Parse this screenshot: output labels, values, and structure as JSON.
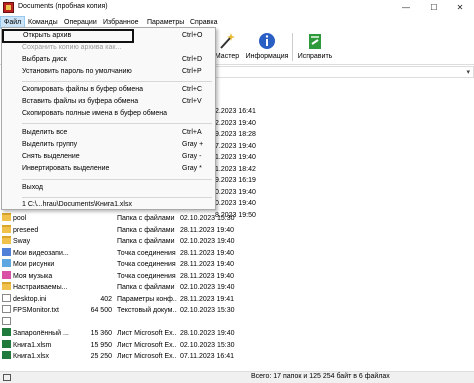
{
  "window": {
    "title": "Documents (пробная копия)"
  },
  "menubar": [
    "Файл",
    "Команды",
    "Операции",
    "Избранное",
    "Параметры",
    "Справка"
  ],
  "toolbar": [
    {
      "label": "Мастер",
      "icon": "wizard-icon"
    },
    {
      "label": "Информация",
      "icon": "info-icon"
    },
    {
      "label": "Исправить",
      "icon": "repair-icon"
    }
  ],
  "file_menu": {
    "items": [
      {
        "label": "Открыть архив",
        "shortcut": "Ctrl+O",
        "enabled": true,
        "highlight": true
      },
      {
        "label": "Сохранить копию архива как...",
        "shortcut": "",
        "enabled": false
      },
      {
        "label": "Выбрать диск",
        "shortcut": "Ctrl+D",
        "enabled": true
      },
      {
        "label": "Установить пароль по умолчанию",
        "shortcut": "Ctrl+P",
        "enabled": true
      },
      {
        "label": "Скопировать файлы в буфер обмена",
        "shortcut": "Ctrl+C",
        "enabled": true
      },
      {
        "label": "Вставить файлы из буфера обмена",
        "shortcut": "Ctrl+V",
        "enabled": true
      },
      {
        "label": "Скопировать полные имена в буфер обмена",
        "shortcut": "",
        "enabled": true
      },
      {
        "label": "Выделить все",
        "shortcut": "Ctrl+A",
        "enabled": true
      },
      {
        "label": "Выделить группу",
        "shortcut": "Gray +",
        "enabled": true
      },
      {
        "label": "Снять выделение",
        "shortcut": "Gray -",
        "enabled": true
      },
      {
        "label": "Инвертировать выделение",
        "shortcut": "Gray *",
        "enabled": true
      },
      {
        "label": "Выход",
        "shortcut": "",
        "enabled": true
      },
      {
        "label": "1  C:\\...hrau\\Documents\\Книга1.xlsx",
        "shortcut": "",
        "enabled": true
      }
    ]
  },
  "file_list": {
    "partial_dates": [
      "2.2023 16:41",
      "2.2023 19:40",
      "9.2023 18:28",
      "7.2023 19:40",
      "1.2023 19:40",
      "1.2023 18:42",
      "9.2023 16:19",
      "0.2023 19:40",
      "0.2023 19:40",
      "8.2023 19:50",
      "9.2023 19:40",
      "2.2023 19:40",
      "2.2023 16:41"
    ],
    "rows": [
      {
        "name": "pool",
        "size": "",
        "type": "Папка с файлами",
        "modified": "02.10.2023 15:30",
        "icon": "folder"
      },
      {
        "name": "preseed",
        "size": "",
        "type": "Папка с файлами",
        "modified": "28.11.2023 19:40",
        "icon": "folder"
      },
      {
        "name": "Sway",
        "size": "",
        "type": "Папка с файлами",
        "modified": "02.10.2023 19:40",
        "icon": "folder"
      },
      {
        "name": "Мои видеозапи...",
        "size": "",
        "type": "Точка соединения",
        "modified": "28.11.2023 19:40",
        "icon": "folder-blue"
      },
      {
        "name": "Мои рисунки",
        "size": "",
        "type": "Точка соединения",
        "modified": "28.11.2023 19:40",
        "icon": "folder-img"
      },
      {
        "name": "Моя музыка",
        "size": "",
        "type": "Точка соединения",
        "modified": "28.11.2023 19:40",
        "icon": "folder-pink"
      },
      {
        "name": "Настраиваемы...",
        "size": "",
        "type": "Папка с файлами",
        "modified": "02.10.2023 19:40",
        "icon": "folder"
      },
      {
        "name": "desktop.ini",
        "size": "402",
        "type": "Параметры конф...",
        "modified": "28.11.2023 19:41",
        "icon": "file"
      },
      {
        "name": "FPSMonitor.txt",
        "size": "64 500",
        "type": "Текстовый докум...",
        "modified": "02.10.2023 15:30",
        "icon": "file"
      },
      {
        "name": "",
        "size": "",
        "type": "",
        "modified": "",
        "icon": "file"
      },
      {
        "name": "Запаролённый ...",
        "size": "15 360",
        "type": "Лист Microsoft Ex...",
        "modified": "28.10.2023 19:40",
        "icon": "excel"
      },
      {
        "name": "Книга1.xlsm",
        "size": "15 950",
        "type": "Лист Microsoft Ex...",
        "modified": "02.10.2023 15:30",
        "icon": "excel"
      },
      {
        "name": "Книга1.xlsx",
        "size": "25 250",
        "type": "Лист Microsoft Ex...",
        "modified": "07.11.2023 16:41",
        "icon": "excel"
      }
    ]
  },
  "statusbar": {
    "text": "Всего: 17 папок и 125 254 байт в 6 файлах"
  }
}
